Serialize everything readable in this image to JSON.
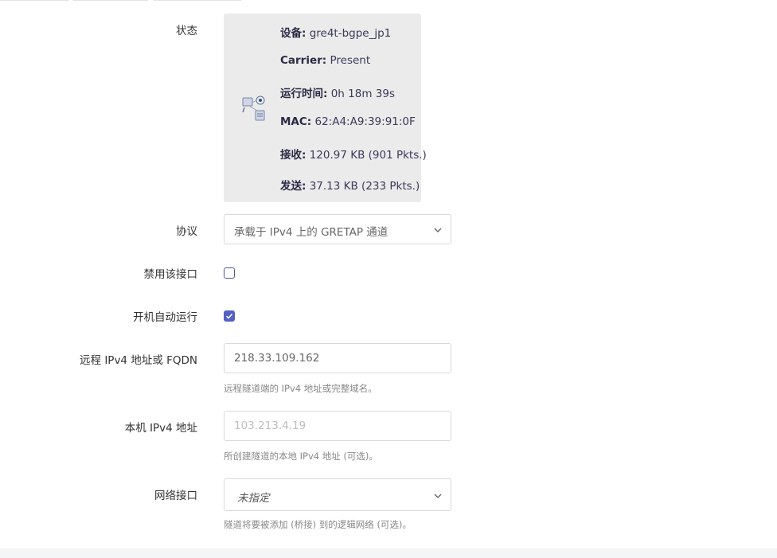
{
  "status": {
    "label": "状态",
    "lines": [
      {
        "key": "设备:",
        "value": "gre4t-bgpe_jp1"
      },
      {
        "key": "Carrier:",
        "value": "Present"
      },
      {
        "key": "运行时间:",
        "value": "0h 18m 39s"
      },
      {
        "key": "MAC:",
        "value": "62:A4:A9:39:91:0F"
      },
      {
        "key": "接收:",
        "value": "120.97 KB (901 Pkts.)"
      },
      {
        "key": "发送:",
        "value": "37.13 KB (233 Pkts.)"
      }
    ],
    "icon": "network-device-icon"
  },
  "protocol": {
    "label": "协议",
    "selected": "承载于 IPv4 上的 GRETAP 通道"
  },
  "disable_interface": {
    "label": "禁用该接口",
    "checked": false
  },
  "auto_start": {
    "label": "开机自动运行",
    "checked": true
  },
  "remote_ipv4": {
    "label": "远程 IPv4 地址或 FQDN",
    "value": "218.33.109.162",
    "help": "远程隧道端的 IPv4 地址或完整域名。"
  },
  "local_ipv4": {
    "label": "本机 IPv4 地址",
    "placeholder": "103.213.4.19",
    "help": "所创建隧道的本地 IPv4 地址 (可选)。"
  },
  "network": {
    "label": "网络接口",
    "selected": "未指定",
    "help": "隧道将要被添加 (桥接) 到的逻辑网络 (可选)。"
  },
  "colors": {
    "accent": "#5460c4",
    "card_bg": "#ebebeb",
    "help_text": "#888888"
  }
}
